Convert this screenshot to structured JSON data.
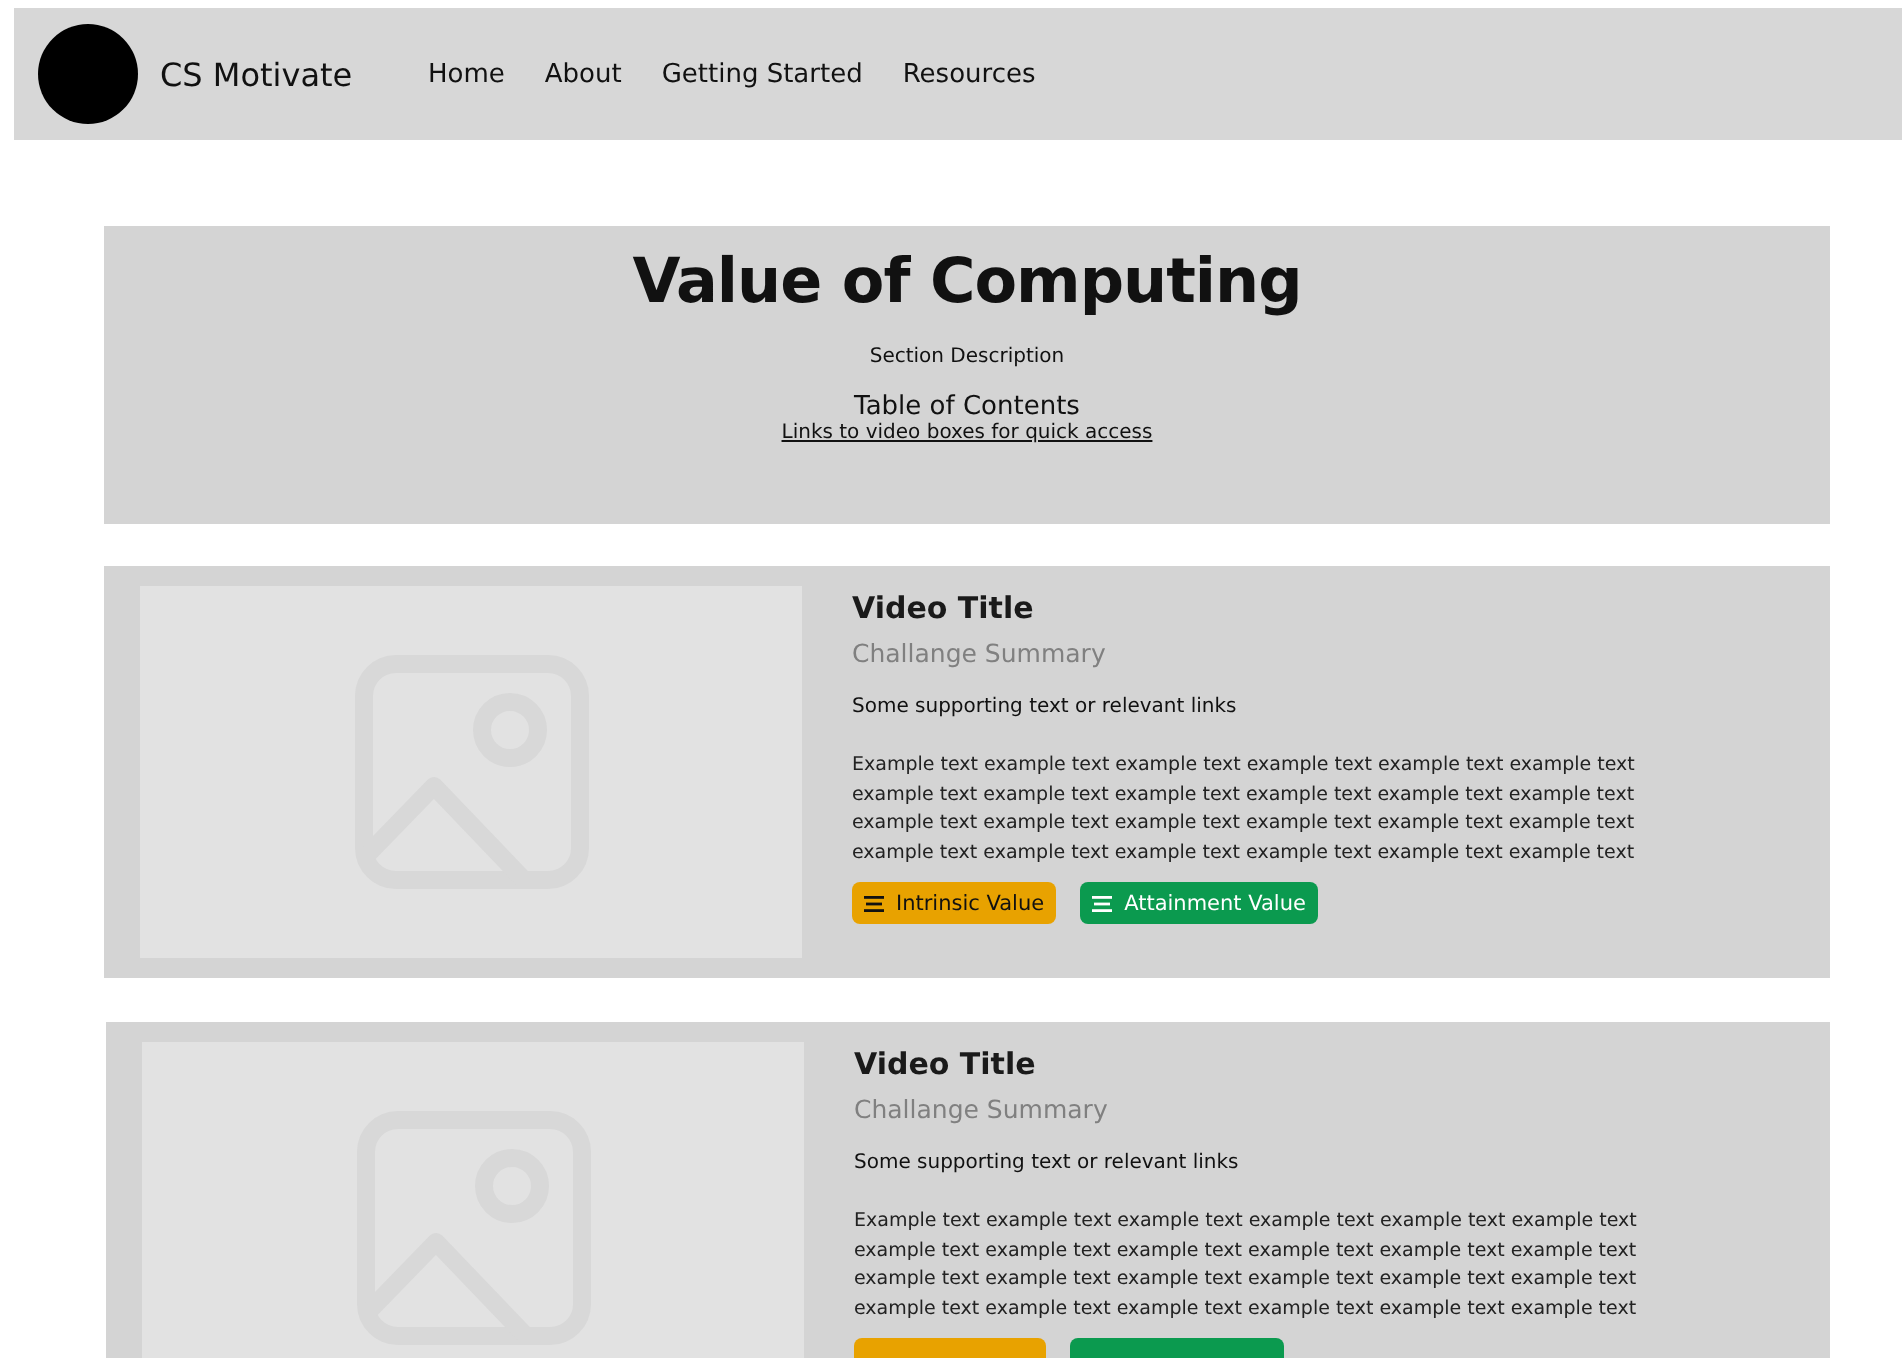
{
  "navbar": {
    "brand": "CS Motivate",
    "links": [
      {
        "label": "Home"
      },
      {
        "label": "About"
      },
      {
        "label": "Getting Started"
      },
      {
        "label": "Resources"
      }
    ]
  },
  "hero": {
    "title": "Value of Computing",
    "description": "Section Description",
    "toc_heading": "Table of Contents",
    "toc_link": "Links to video boxes for quick access"
  },
  "cards": [
    {
      "title": "Video Title",
      "summary": "Challange Summary",
      "supporting": "Some supporting text or relevant links",
      "body": "Example text example text example text example text example text example text example text example text example text example text example text example text example text example text example text example text example text example text example text example text example text example text example text example text",
      "tags": [
        {
          "label": "Intrinsic Value",
          "color": "#e8a200"
        },
        {
          "label": "Attainment Value",
          "color": "#0b9a4f"
        }
      ]
    },
    {
      "title": "Video Title",
      "summary": "Challange Summary",
      "supporting": "Some supporting text or relevant links",
      "body": "Example text example text example text example text example text example text example text example text example text example text example text example text example text example text example text example text example text example text example text example text example text example text example text example text",
      "tags": [
        {
          "color": "#e8a200"
        },
        {
          "color": "#0b9a4f"
        }
      ]
    }
  ]
}
